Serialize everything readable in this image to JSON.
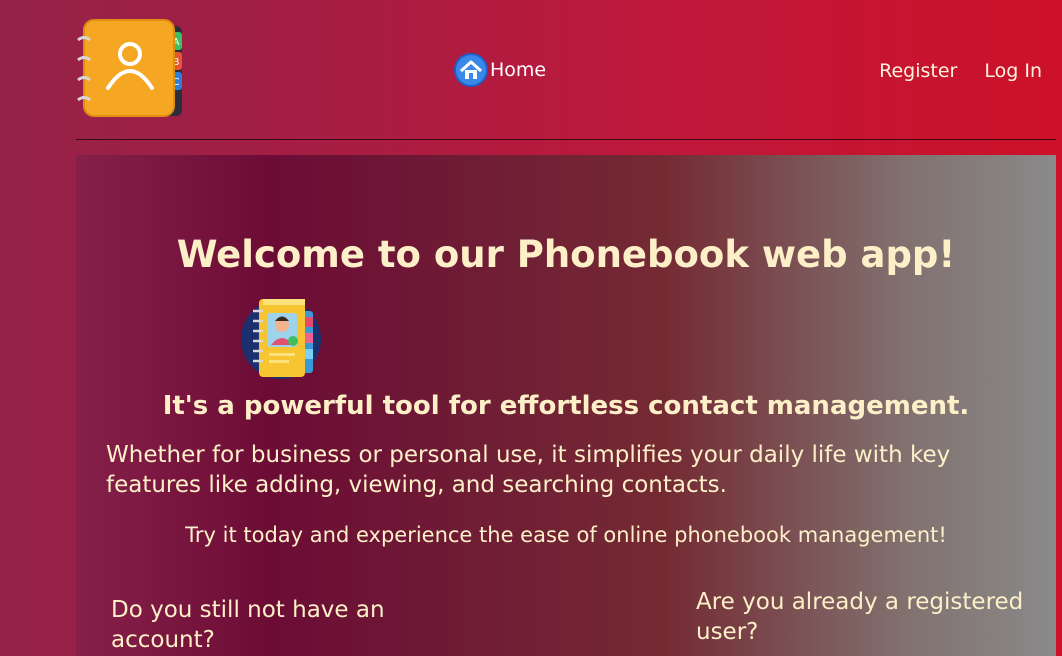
{
  "nav": {
    "home_label": "Home",
    "register_label": "Register",
    "login_label": "Log In",
    "logo_tab_letters": [
      "A",
      "B",
      "C"
    ]
  },
  "main": {
    "title": "Welcome to our Phonebook web app!",
    "subtitle": "It's a powerful tool for effortless contact management.",
    "description": "Whether for business or personal use, it simplifies your daily life with key features like adding, viewing, and searching contacts.",
    "cta": "Try it today and experience the ease of online phonebook management!",
    "no_account_question": "Do you still not have an account?",
    "registered_question": "Are you already a registered user?"
  },
  "icons": {
    "logo": "address-book-icon",
    "home": "home-icon",
    "illustration": "phonebook-illustration-icon"
  },
  "colors": {
    "header_gradient_start": "#95224a",
    "header_gradient_end": "#cc1128",
    "text_cream": "#fdf0c8",
    "logo_orange": "#f5a623"
  }
}
